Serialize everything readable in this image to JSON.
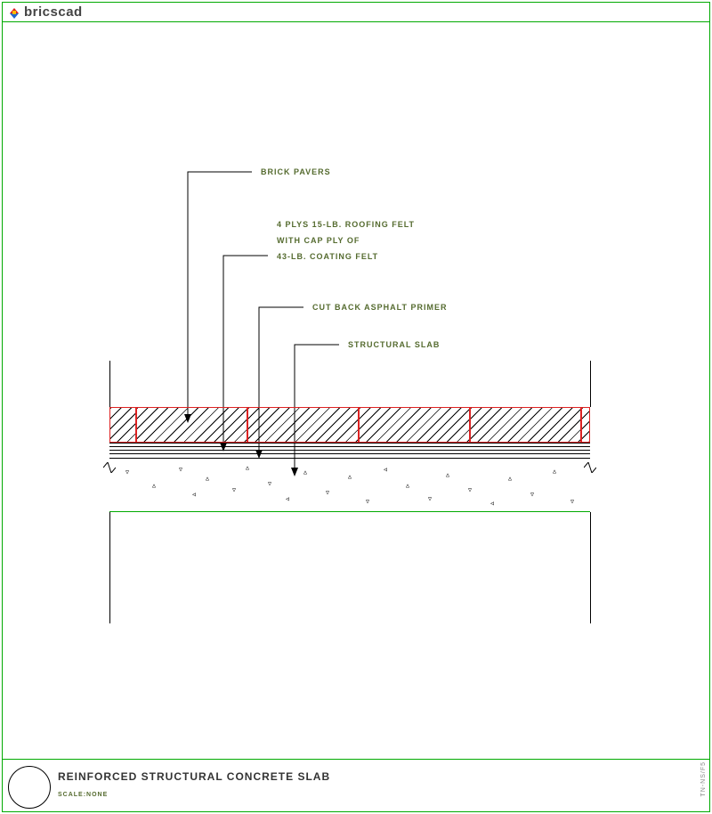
{
  "brand": "bricscad",
  "labels": {
    "brick_pavers": "BRICK PAVERS",
    "felt_line1": "4 PLYS 15-LB. ROOFING FELT",
    "felt_line2": "WITH CAP PLY OF",
    "felt_line3": "43-LB. COATING FELT",
    "primer": "CUT BACK ASPHALT PRIMER",
    "slab": "STRUCTURAL SLAB"
  },
  "title": "REINFORCED STRUCTURAL CONCRETE SLAB",
  "scale": "SCALE:NONE",
  "drawing_id": "TN-NS/F5"
}
